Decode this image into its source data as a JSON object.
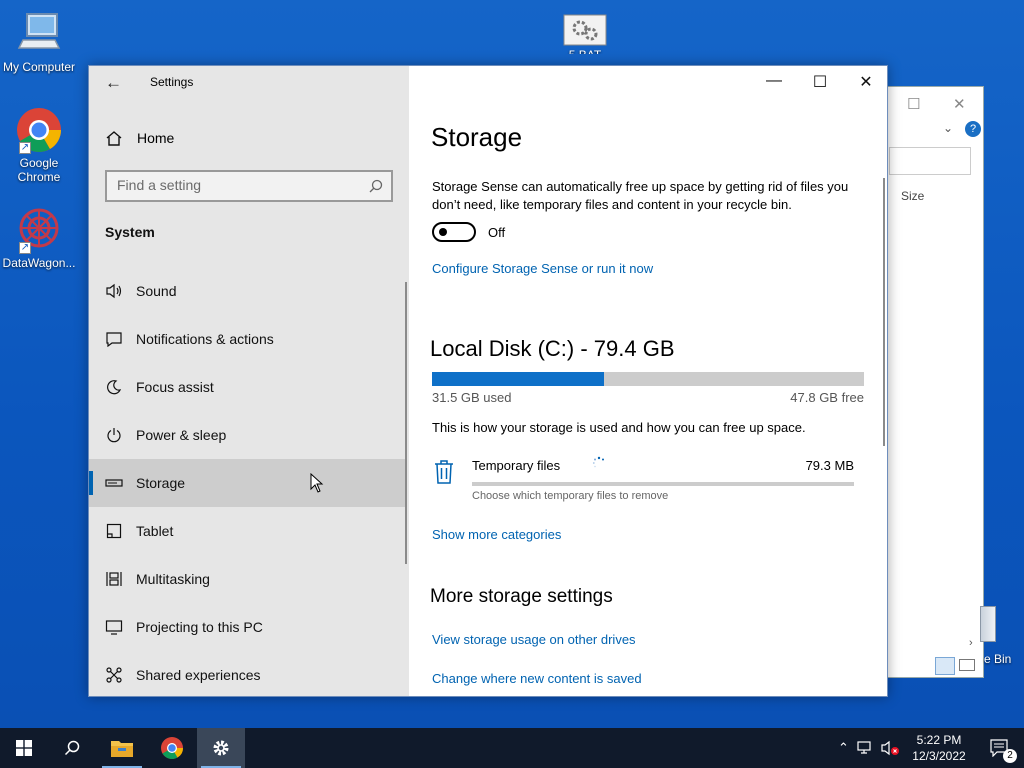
{
  "desktop": {
    "icons": [
      {
        "label": "My Computer"
      },
      {
        "label": "Google Chrome"
      },
      {
        "label": "DataWagon..."
      },
      {
        "label": "5 BAT"
      },
      {
        "label": "e Bin"
      }
    ]
  },
  "settings": {
    "title": "Settings",
    "home_label": "Home",
    "search_placeholder": "Find a setting",
    "section": "System",
    "nav": [
      {
        "label": "Sound",
        "icon": "speaker-icon"
      },
      {
        "label": "Notifications & actions",
        "icon": "notification-icon"
      },
      {
        "label": "Focus assist",
        "icon": "moon-icon"
      },
      {
        "label": "Power & sleep",
        "icon": "power-icon"
      },
      {
        "label": "Storage",
        "icon": "storage-icon",
        "selected": true
      },
      {
        "label": "Tablet",
        "icon": "tablet-icon"
      },
      {
        "label": "Multitasking",
        "icon": "multitasking-icon"
      },
      {
        "label": "Projecting to this PC",
        "icon": "projector-icon"
      },
      {
        "label": "Shared experiences",
        "icon": "share-icon"
      }
    ],
    "page": {
      "heading": "Storage",
      "sense_desc": "Storage Sense can automatically free up space by getting rid of files you don’t need, like temporary files and content in your recycle bin.",
      "toggle_state": "Off",
      "configure_link": "Configure Storage Sense or run it now",
      "disk_title": "Local Disk (C:) - 79.4 GB",
      "used_fraction": 0.397,
      "used_label": "31.5 GB used",
      "free_label": "47.8 GB free",
      "usage_desc": "This is how your storage is used and how you can free up space.",
      "category": {
        "name": "Temporary files",
        "size": "79.3 MB",
        "desc": "Choose which temporary files to remove"
      },
      "show_more_link": "Show more categories",
      "more_heading": "More storage settings",
      "link_other_drives": "View storage usage on other drives",
      "link_change_location": "Change where new content is saved"
    }
  },
  "taskbar": {
    "time": "5:22 PM",
    "date": "12/3/2022",
    "notification_count": "2"
  },
  "colors": {
    "accent": "#0063b1",
    "desktop": "#0b56bd",
    "taskbar": "#101a2b"
  }
}
